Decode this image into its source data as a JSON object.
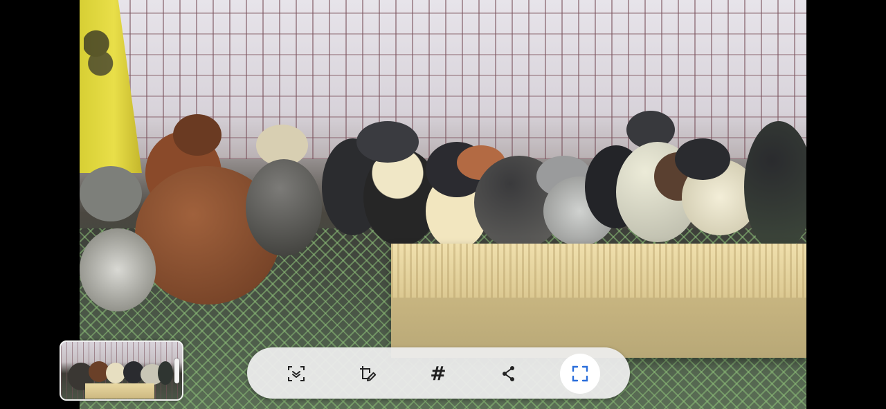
{
  "screen": {
    "description_label": "",
    "accent_color": "#2a6edb"
  },
  "thumbnail": {
    "icon": "screenshot-thumbnail"
  },
  "toolbar": {
    "buttons": [
      {
        "id": "scroll-capture",
        "icon": "scroll-capture-icon",
        "label": ""
      },
      {
        "id": "edit",
        "icon": "crop-edit-icon",
        "label": ""
      },
      {
        "id": "tag",
        "icon": "hashtag-icon",
        "label": "#"
      },
      {
        "id": "share",
        "icon": "share-icon",
        "label": ""
      },
      {
        "id": "smart-select",
        "icon": "smart-select-icon",
        "label": "",
        "active": true
      }
    ]
  }
}
